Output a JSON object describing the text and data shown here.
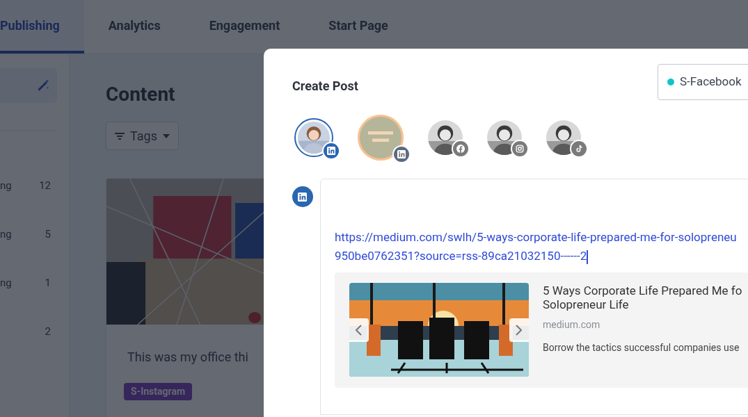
{
  "nav": {
    "tabs": [
      {
        "label": "Publishing",
        "selected": true
      },
      {
        "label": "Analytics",
        "selected": false
      },
      {
        "label": "Engagement",
        "selected": false
      },
      {
        "label": "Start Page",
        "selected": false
      }
    ]
  },
  "sidebar": {
    "items": [
      {
        "label": "ng",
        "count": "12"
      },
      {
        "label": "ng",
        "count": "5"
      },
      {
        "label": "ng",
        "count": "1"
      },
      {
        "count": "2"
      }
    ]
  },
  "content": {
    "title": "Content",
    "filter": "Tags",
    "card": {
      "text": "This was my office thi",
      "tag": "S-Instagram"
    }
  },
  "modal": {
    "title": "Create Post",
    "channel_select": {
      "value": "S-Facebook",
      "color": "#10c4c8"
    },
    "accounts": [
      {
        "kind": "linkedin",
        "avatar": {
          "kind": "person"
        },
        "selected": true,
        "hovered": false
      },
      {
        "kind": "linkedin",
        "avatar": {
          "kind": "logo"
        },
        "selected": false,
        "hovered": true
      },
      {
        "kind": "facebook",
        "avatar": {
          "kind": "person"
        },
        "selected": false,
        "hovered": false
      },
      {
        "kind": "instagram",
        "avatar": {
          "kind": "person"
        },
        "selected": false,
        "hovered": false
      },
      {
        "kind": "tiktok",
        "avatar": {
          "kind": "person"
        },
        "selected": false,
        "hovered": false
      }
    ],
    "editor": {
      "kind": "linkedin",
      "url_lines": [
        "https://medium.com/swlh/5-ways-corporate-life-prepared-me-for-solopreneu",
        "950be0762351?source=rss-89ca21032150------2"
      ],
      "preview": {
        "title_lines": [
          "5 Ways Corporate Life Prepared Me fo",
          "Solopreneur Life"
        ],
        "domain": "medium.com",
        "description": "Borrow the tactics successful companies use"
      }
    }
  }
}
